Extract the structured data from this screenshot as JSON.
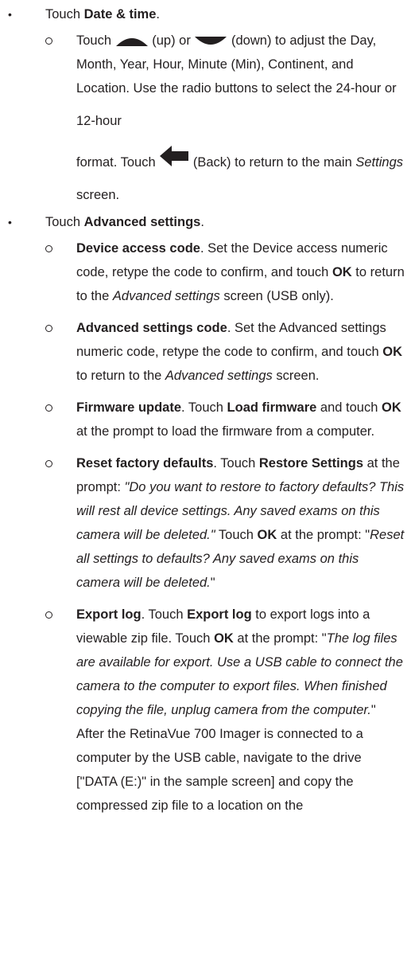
{
  "items": [
    {
      "touch": "Touch",
      "name": "Date & time",
      "period": ".",
      "sub": [
        {
          "t1": "Touch",
          "up_label": "(up) or",
          "down_label": "(down) to adjust the Day, Month, Year, Hour, Minute (Min), Continent, and Location. Use the radio buttons to select the 24-hour or 12-hour",
          "t2": "format. Touch",
          "back_label": "(Back) to return to the main",
          "settings_italic": "Settings",
          "t3": "screen."
        }
      ]
    },
    {
      "touch": "Touch",
      "name": "Advanced settings",
      "period": ".",
      "sub": [
        {
          "title": "Device access code",
          "a": ". Set the Device access numeric code, retype the code to confirm, and touch",
          "ok": "OK",
          "b": "to return to the",
          "ital": "Advanced settings",
          "c": "screen (USB only)."
        },
        {
          "title": "Advanced settings code",
          "a": ". Set the Advanced settings numeric code, retype the code to confirm, and touch",
          "ok": "OK",
          "b": "to return to the",
          "ital": "Advanced settings",
          "c": "screen."
        },
        {
          "title": "Firmware update",
          "a": ". Touch",
          "load": "Load firmware",
          "b": "and touch",
          "ok": "OK",
          "c": "at the prompt to load the firmware from a computer."
        },
        {
          "title": "Reset factory defaults",
          "a": ". Touch",
          "restore": "Restore Settings",
          "b": "at the prompt:",
          "q1": "\"Do you want to restore to factory defaults? This will rest all device settings. Any saved exams on this camera will be deleted.\"",
          "c": "Touch",
          "ok": "OK",
          "d": "at the prompt: \"",
          "q2": "Reset all settings to defaults? Any saved exams on this camera will be deleted.",
          "e": "\""
        },
        {
          "title": "Export log",
          "a": ". Touch",
          "export": "Export log",
          "b": "to export logs into a viewable zip file. Touch",
          "ok": "OK",
          "c": "at the prompt: \"",
          "q1": "The log files are available for export. Use a USB cable to connect the camera to the computer to export files. When finished copying the file, unplug camera from the computer.",
          "d": "\" After the RetinaVue 700 Imager is connected to a computer by the USB cable, navigate to the drive [\"DATA (E:)\" in the sample screen] and copy the compressed zip file to a location on the"
        }
      ]
    }
  ]
}
